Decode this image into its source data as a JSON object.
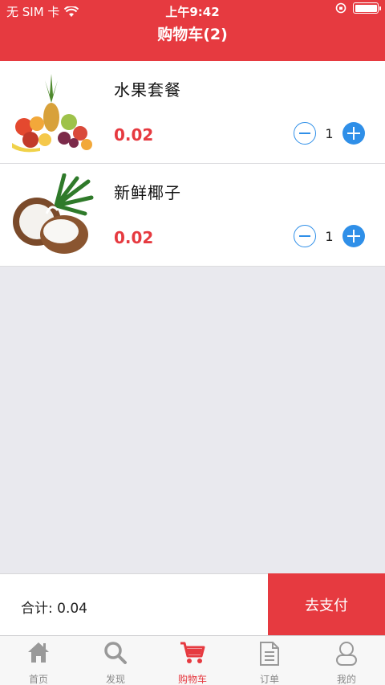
{
  "status_bar": {
    "carrier": "无 SIM 卡",
    "time": "上午9:42"
  },
  "nav": {
    "title": "购物车(2)"
  },
  "cart": {
    "items": [
      {
        "name": "水果套餐",
        "price": "0.02",
        "quantity": "1",
        "image": "fruit-platter-image"
      },
      {
        "name": "新鲜椰子",
        "price": "0.02",
        "quantity": "1",
        "image": "coconut-image"
      }
    ]
  },
  "checkout": {
    "total": "合计: 0.04",
    "pay_label": "去支付"
  },
  "tabbar": {
    "tabs": [
      {
        "label": "首页",
        "icon": "home-icon"
      },
      {
        "label": "发现",
        "icon": "search-icon"
      },
      {
        "label": "购物车",
        "icon": "cart-icon",
        "active": true
      },
      {
        "label": "订单",
        "icon": "document-icon"
      },
      {
        "label": "我的",
        "icon": "user-icon"
      }
    ]
  },
  "colors": {
    "accent": "#e63a40",
    "action_blue": "#2f8fe8"
  }
}
